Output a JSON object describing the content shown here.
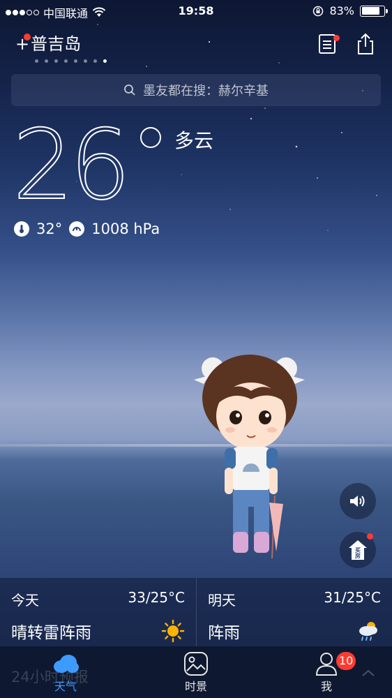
{
  "status_bar": {
    "carrier": "中国联通",
    "time": "19:58",
    "battery_percent": "83%",
    "battery_level": 0.83,
    "signal_bars_filled": 3,
    "signal_bars_total": 5
  },
  "header": {
    "add_symbol": "+",
    "city": "普吉岛",
    "page_count": 8,
    "active_page_index": 7
  },
  "search": {
    "text": "墨友都在搜：赫尔辛基"
  },
  "current": {
    "temperature": "26",
    "condition": "多云",
    "feels_like": "32°",
    "pressure": "1008 hPa"
  },
  "forecast": {
    "today": {
      "label": "今天",
      "range": "33/25°C",
      "condition": "晴转雷阵雨",
      "icon": "sun-icon"
    },
    "tomorrow": {
      "label": "明天",
      "range": "31/25°C",
      "condition": "阵雨",
      "icon": "sun-cloud-rain-icon"
    }
  },
  "floating": {
    "house_label_top": "买",
    "house_label_bottom": "房"
  },
  "bottom": {
    "peek_text": "24小时预报",
    "tabs": [
      {
        "label": "天气",
        "icon": "cloud-icon",
        "active": true
      },
      {
        "label": "时景",
        "icon": "photo-icon",
        "active": false
      },
      {
        "label": "我",
        "icon": "person-icon",
        "active": false,
        "badge": "10"
      }
    ]
  },
  "colors": {
    "accent": "#3d9bff",
    "badge": "#ff3b30",
    "sun": "#ffb400"
  }
}
